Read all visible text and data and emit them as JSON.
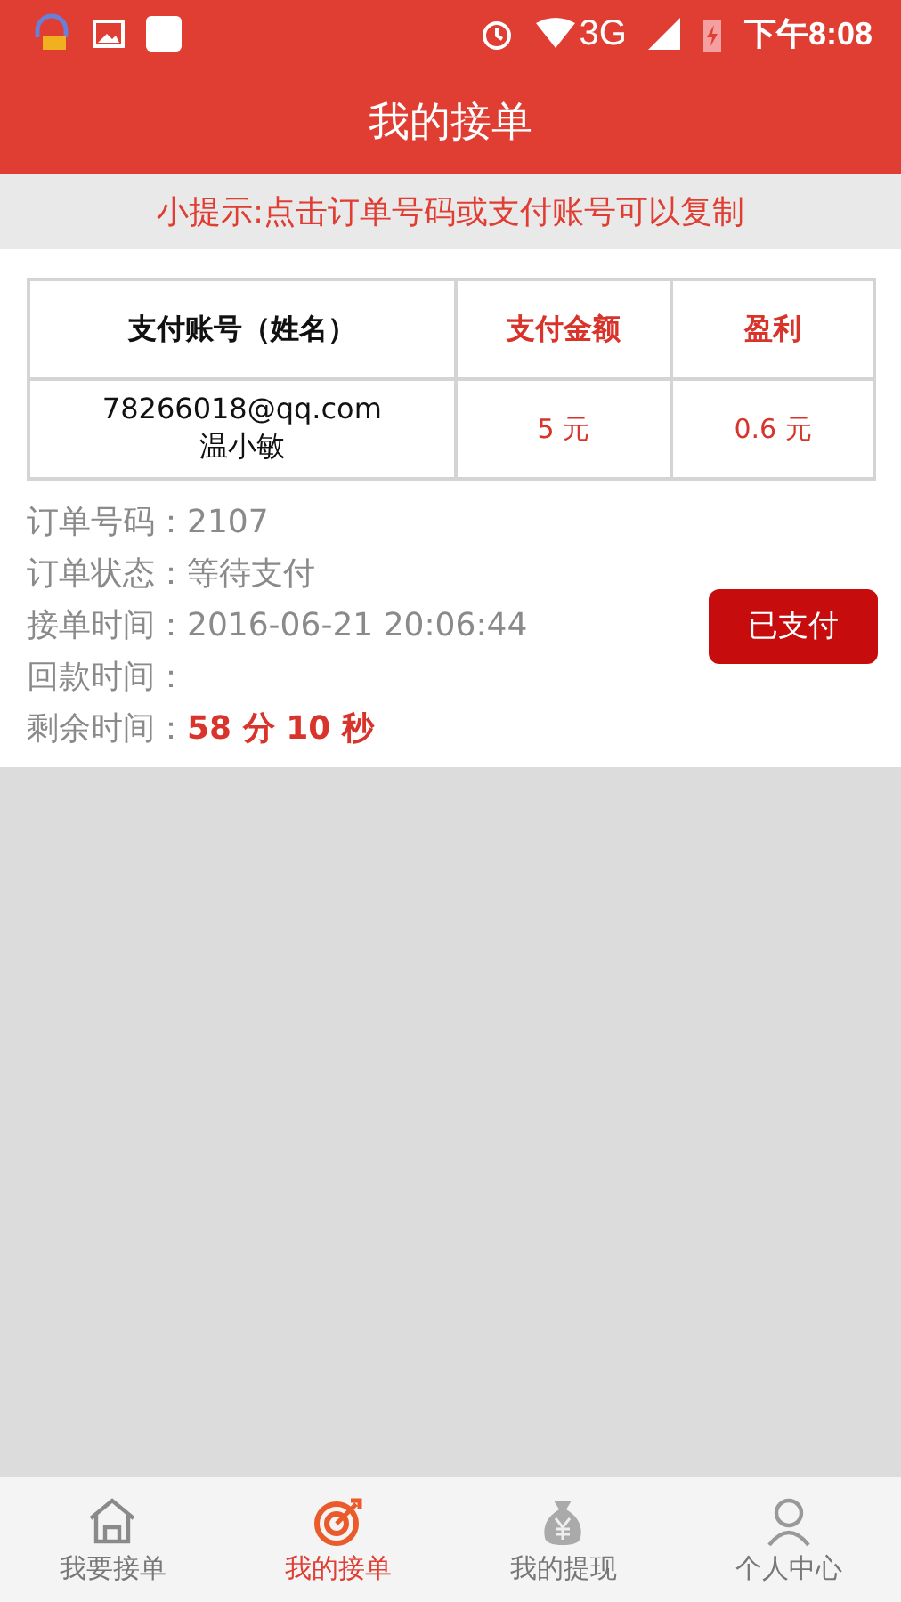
{
  "status_bar": {
    "network": "3G",
    "time": "下午8:08"
  },
  "header": {
    "title": "我的接单"
  },
  "tip": "小提示:点击订单号码或支付账号可以复制",
  "table": {
    "columns": [
      {
        "label": "支付账号（姓名）",
        "kind": "plain"
      },
      {
        "label": "支付金额",
        "kind": "money"
      },
      {
        "label": "盈利",
        "kind": "money"
      }
    ],
    "rows": [
      {
        "account": "78266018@qq.com",
        "name": "温小敏",
        "amount": "5 元",
        "profit": "0.6 元"
      }
    ]
  },
  "details": [
    {
      "label": "订单号码：",
      "value": "2107",
      "kind": "plain"
    },
    {
      "label": "订单状态：",
      "value": "等待支付",
      "kind": "plain"
    },
    {
      "label": "接单时间：",
      "value": "2016-06-21 20:06:44",
      "kind": "plain"
    },
    {
      "label": "回款时间：",
      "kind": "plain"
    },
    {
      "label": "剩余时间：",
      "value": "58 分 10 秒",
      "kind": "highlight"
    }
  ],
  "action_button": "已支付",
  "bottom_nav": [
    {
      "label": "我要接单",
      "kind": "home",
      "selected": false
    },
    {
      "label": "我的接单",
      "kind": "target",
      "selected": true
    },
    {
      "label": "我的提现",
      "kind": "moneybag",
      "selected": false
    },
    {
      "label": "个人中心",
      "kind": "person",
      "selected": false
    }
  ]
}
